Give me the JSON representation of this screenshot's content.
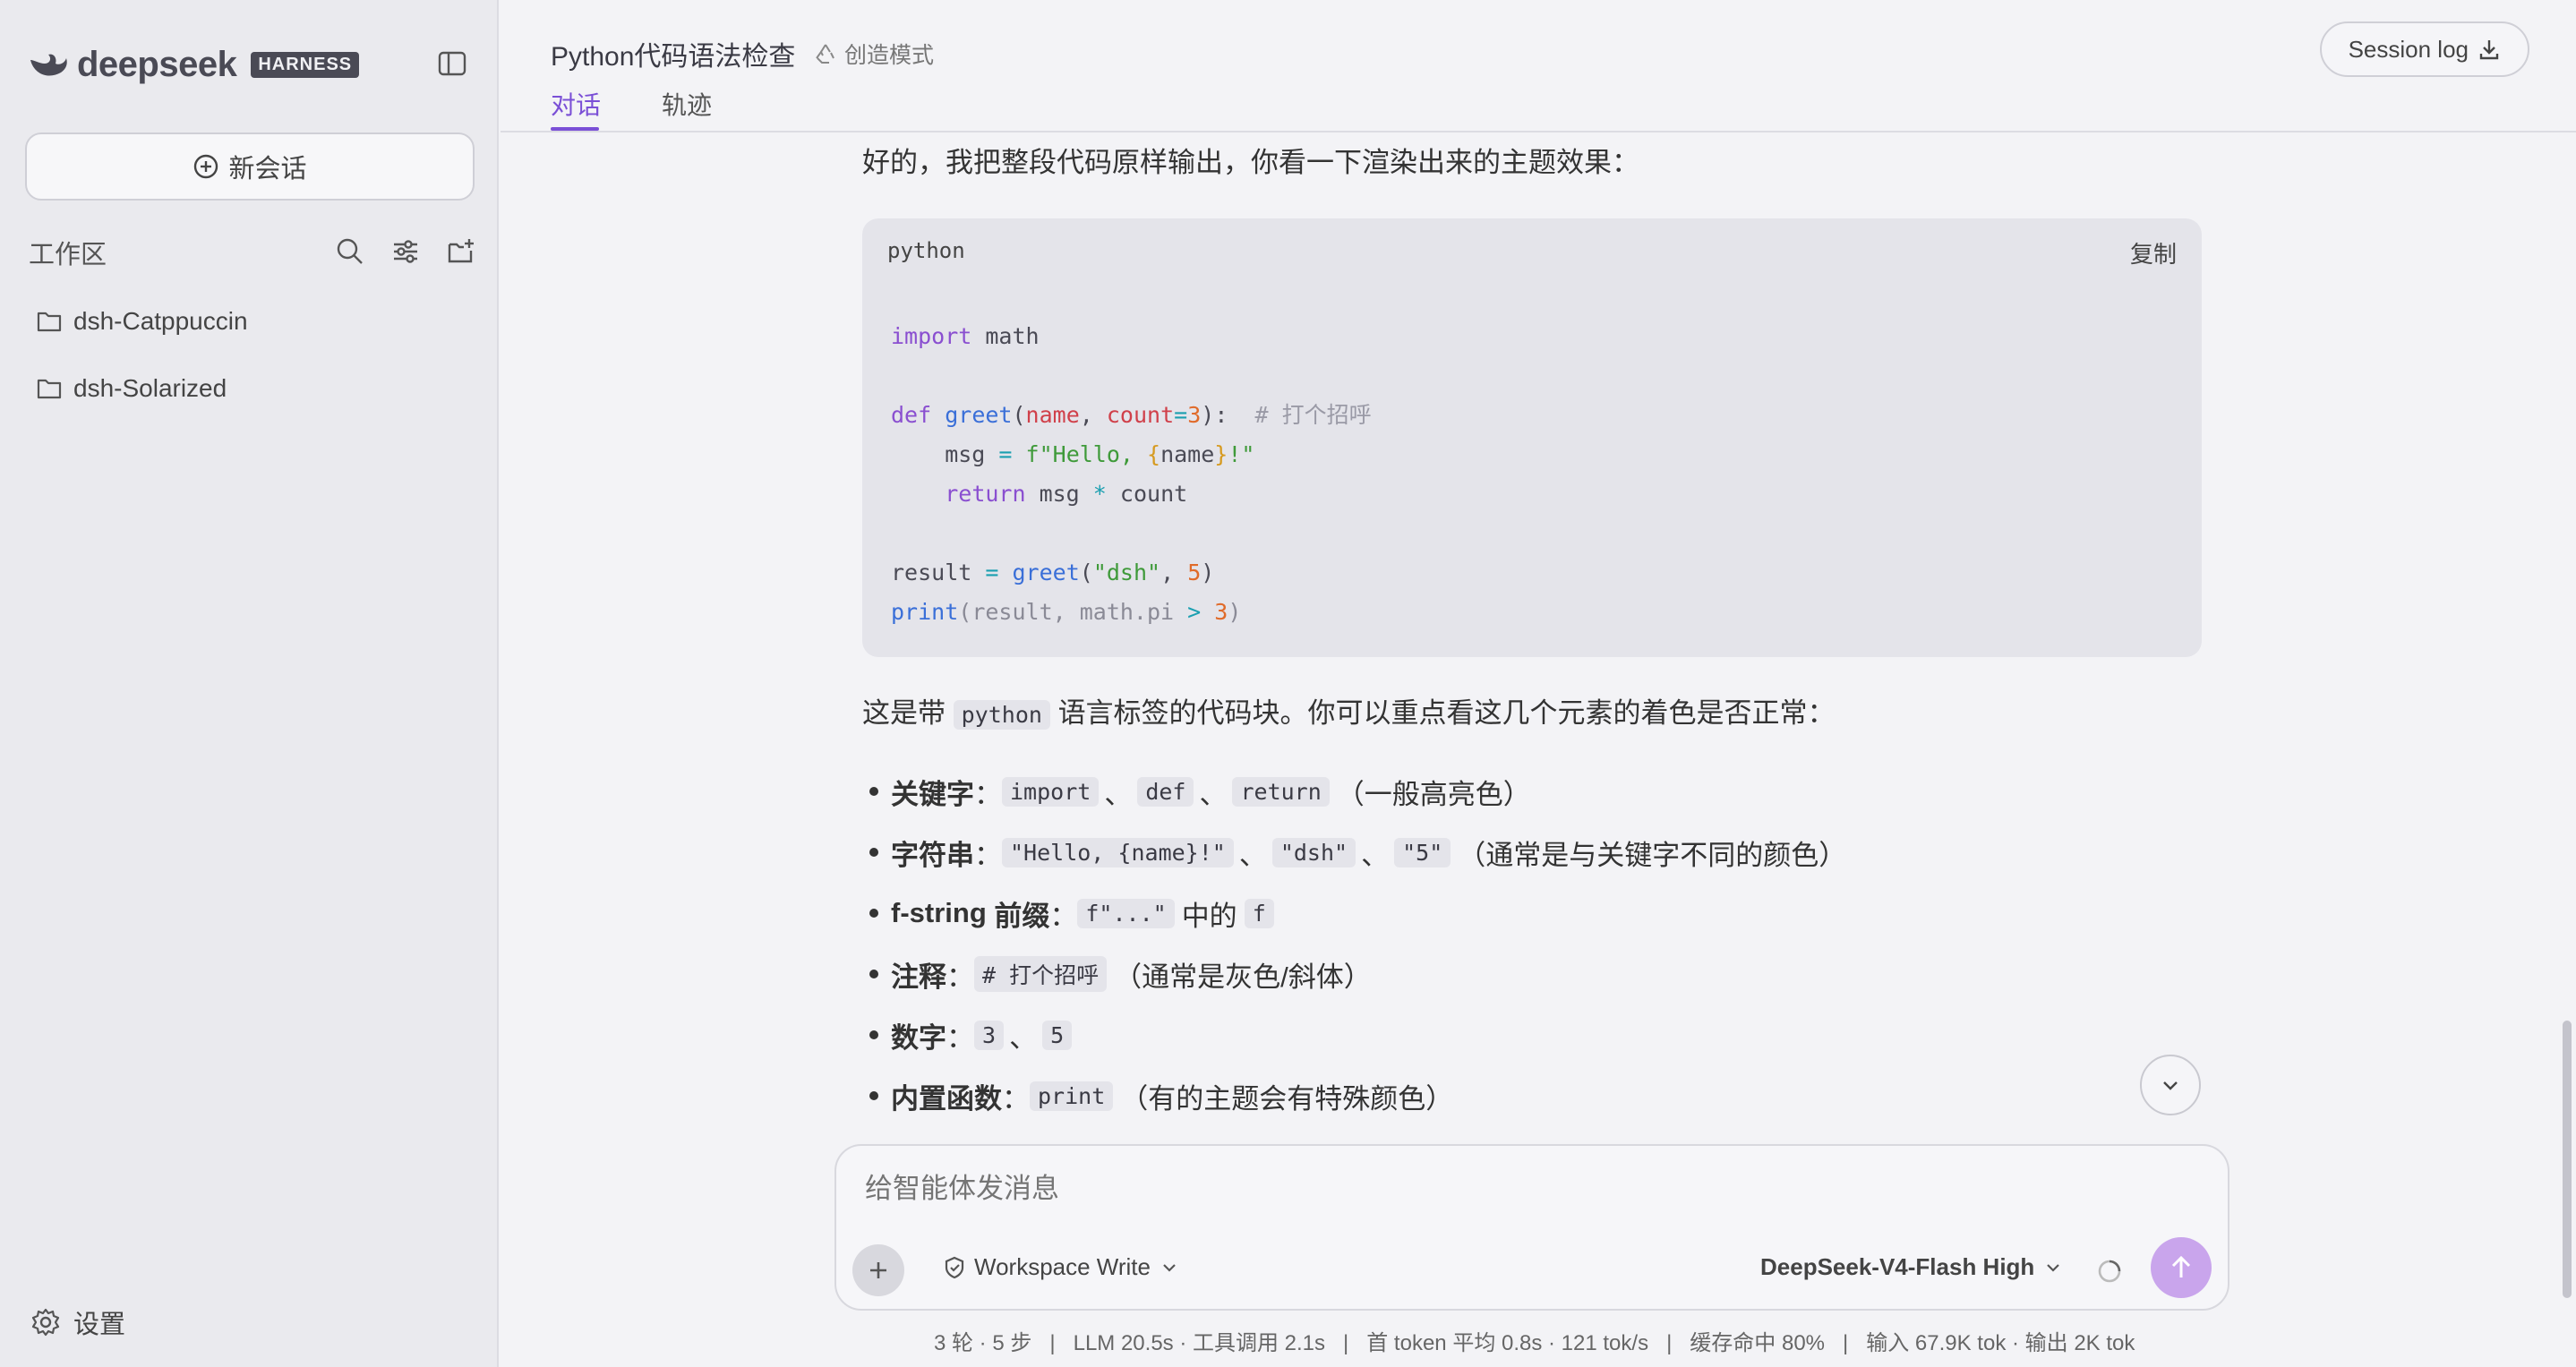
{
  "sidebar": {
    "logo_text": "deepseek",
    "logo_badge": "HARNESS",
    "new_chat_label": "新会话",
    "workspace_label": "工作区",
    "folders": [
      "dsh-Catppuccin",
      "dsh-Solarized"
    ],
    "settings_label": "设置"
  },
  "header": {
    "title": "Python代码语法检查",
    "mode": "创造模式",
    "tabs": [
      "对话",
      "轨迹"
    ],
    "active_tab": "对话",
    "session_log": "Session log"
  },
  "message": {
    "intro": "好的，我把整段代码原样输出，你看一下渲染出来的主题效果：",
    "code": {
      "language": "python",
      "copy_label": "复制"
    },
    "desc_before": "这是带",
    "desc_code": "python",
    "desc_after": "语言标签的代码块。你可以重点看这几个元素的着色是否正常：",
    "bullets": [
      {
        "label": "关键字",
        "codes": [
          "import",
          "def",
          "return"
        ],
        "note": "（一般高亮色）"
      },
      {
        "label": "字符串",
        "codes": [
          "\"Hello, {name}!\"",
          "\"dsh\"",
          "\"5\""
        ],
        "note": "（通常是与关键字不同的颜色）"
      },
      {
        "label_plain": "f-string ",
        "label": "前缀",
        "codes": [
          "f\"...\""
        ],
        "middle": "中的",
        "codes2": [
          "f"
        ]
      },
      {
        "label": "注释",
        "codes": [
          "# 打个招呼"
        ],
        "note": "（通常是灰色/斜体）"
      },
      {
        "label": "数字",
        "codes": [
          "3",
          "5"
        ]
      },
      {
        "label": "内置函数",
        "codes": [
          "print"
        ],
        "note": "（有的主题会有特殊颜色）"
      }
    ]
  },
  "composer": {
    "placeholder": "给智能体发消息",
    "workspace_mode": "Workspace Write",
    "model": "DeepSeek-V4-Flash High"
  },
  "stats": "3 轮 · 5 步   |   LLM 20.5s · 工具调用 2.1s   |   首 token 平均 0.8s · 121 tok/s   |   缓存命中 80%   |   输入 67.9K tok · 输出 2K tok",
  "colors": {
    "accent": "#7a4fd6",
    "send_button": "#c9a5ec",
    "keyword": "#8a4fd0",
    "function": "#3a6fd8",
    "string": "#3f9a3a",
    "number": "#e06b2a"
  }
}
